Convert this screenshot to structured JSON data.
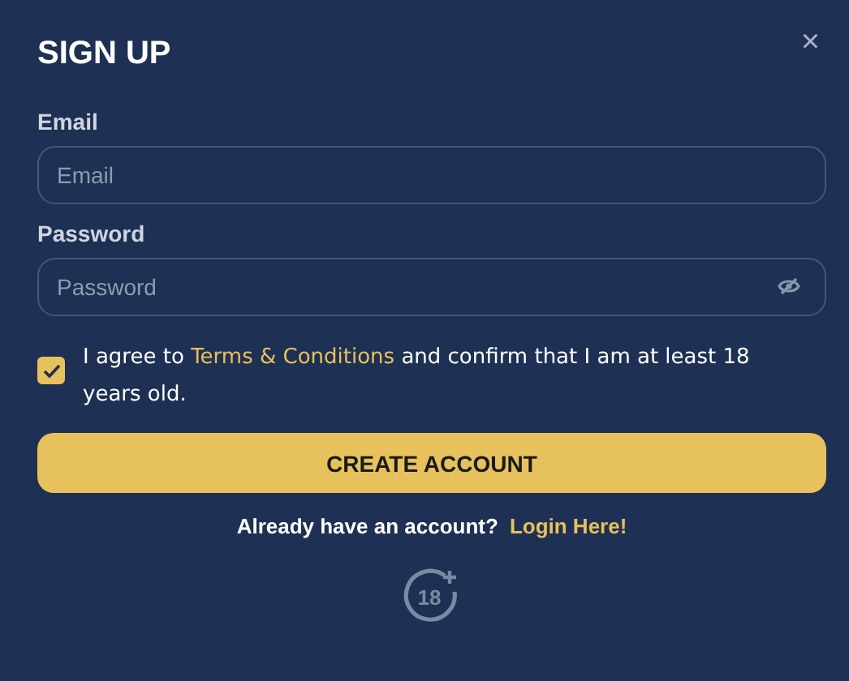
{
  "dialog": {
    "title": "SIGN UP",
    "close": "×"
  },
  "fields": [
    {
      "label": "Email",
      "placeholder": "Email",
      "kind": "text"
    },
    {
      "label": "Password",
      "placeholder": "Password",
      "kind": "password"
    }
  ],
  "agreement": {
    "checked": true,
    "before": "I agree to ",
    "link": "Terms & Conditions",
    "after": " and confirm that I am at least 18 years old."
  },
  "submit": "CREATE ACCOUNT",
  "footer": {
    "question": "Already have an account?",
    "link": "Login Here!"
  },
  "age_badge": "18"
}
